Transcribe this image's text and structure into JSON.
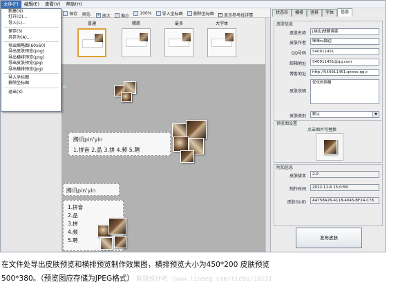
{
  "menubar": {
    "items": [
      {
        "label": "文件(F)",
        "active": true
      },
      {
        "label": "编辑(E)",
        "active": false
      },
      {
        "label": "查看(V)",
        "active": false
      },
      {
        "label": "帮助(H)",
        "active": false
      }
    ]
  },
  "file_menu": {
    "items": [
      {
        "label": "新建(N)"
      },
      {
        "label": "打开(O)..."
      },
      {
        "label": "导入(L)..."
      },
      {
        "sep": true
      },
      {
        "label": "保存(S)"
      },
      {
        "label": "另存为(A)..."
      },
      {
        "sep": true
      },
      {
        "label": "导出缩略图(60x60)"
      },
      {
        "label": "导出皮肤预览(png)"
      },
      {
        "label": "导出横排预览(png)"
      },
      {
        "label": "导出皮肤预览(jpg)"
      },
      {
        "label": "导出横排预览(jpg)"
      },
      {
        "sep": true
      },
      {
        "label": "导入坐标图"
      },
      {
        "label": "移除坐标图"
      },
      {
        "sep": true
      },
      {
        "label": "退出(X)"
      }
    ]
  },
  "toolbar": {
    "save_label": "保存",
    "preview_label": "预览:",
    "zoom_in_label": "放大",
    "zoom_out_label": "缩小",
    "zoom_100_label": "100%",
    "import_coord_label": "导入坐标图",
    "remove_coord_label": "删除坐标图",
    "show_ref_label": "显示参考线详情",
    "show_ref_checked": true
  },
  "thumbnails": [
    {
      "label": "普通",
      "selected": true
    },
    {
      "label": "精简",
      "selected": false
    },
    {
      "label": "最多",
      "selected": false
    },
    {
      "label": "大字体",
      "selected": false
    }
  ],
  "preview": {
    "horizontal": {
      "input": "腾讯pin'yin",
      "candidates": "1.拼音 2.品 3.拼 4.频 5.聘"
    },
    "vertical": {
      "input": "腾讯pin'yin",
      "candidates": [
        "1.拼音",
        "2.品",
        "3.拼",
        "4.频",
        "5.聘"
      ]
    }
  },
  "side_tabs": [
    {
      "label": "状态栏",
      "active": false
    },
    {
      "label": "横排",
      "active": false
    },
    {
      "label": "竖排",
      "active": false
    },
    {
      "label": "字体",
      "active": false
    },
    {
      "label": "信息",
      "active": true
    }
  ],
  "skin_info": {
    "title": "皮肤信息",
    "fields": [
      {
        "label": "皮肤名称",
        "value": "[描边]想要诱惑"
      },
      {
        "label": "皮肤作者",
        "value": "咪咪ru描边"
      },
      {
        "label": "QQ号码",
        "value": "540911451"
      },
      {
        "label": "邮箱地址",
        "value": "540911451@qq.com"
      },
      {
        "label": "博客地址",
        "value": "http://540911451.qzone.qq.c"
      }
    ],
    "desc_label": "皮肤说明",
    "desc_value": "优化的网楼",
    "category_label": "皮肤类别",
    "category_value": "默认"
  },
  "preview_settings": {
    "title": "预览图设置",
    "hint": "点击图片可替换"
  },
  "extra_info": {
    "title": "附加信息",
    "fields": [
      {
        "label": "皮肤版本",
        "value": "2.0"
      },
      {
        "label": "制作时间",
        "value": "2012-11-6 15:0:58"
      },
      {
        "label": "皮肤GUID",
        "value": "A4758A26-4118-4045-BF24-C78"
      }
    ]
  },
  "publish_label": "发布皮肤",
  "caption": {
    "line1": "在文件处导出皮肤预览和横排预览制作效果图，横排预览大小为450*200 皮肤预览",
    "line2": "500*380。（预览图应存储为JPEG格式）",
    "watermark": "联盟设计吧 [www.lineeg.com/tieba/1822]"
  }
}
